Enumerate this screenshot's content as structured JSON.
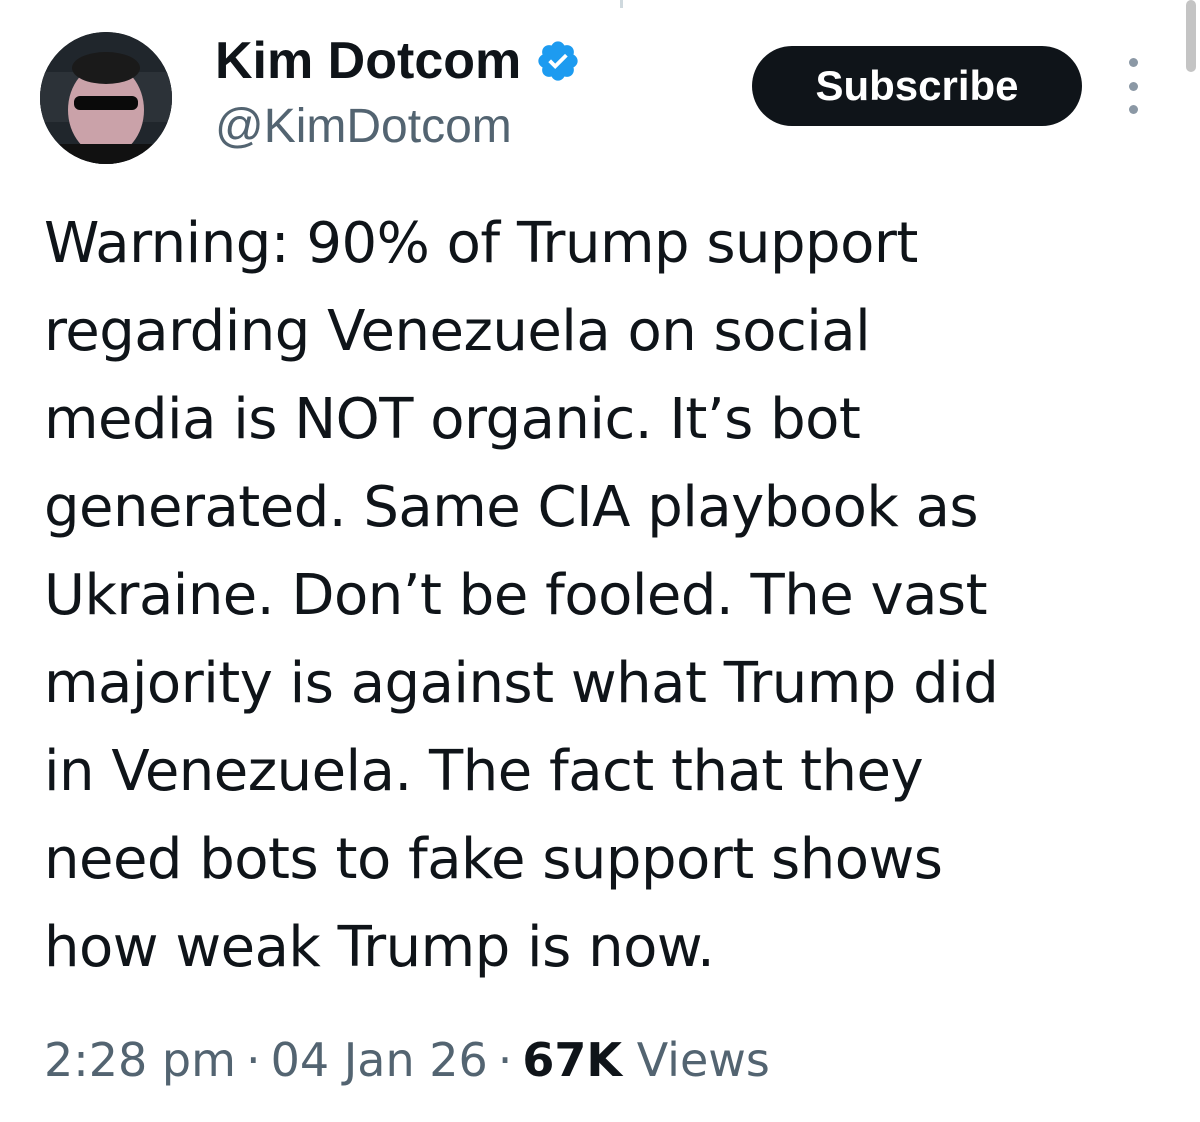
{
  "author": {
    "display_name": "Kim Dotcom",
    "handle": "@KimDotcom",
    "verified": true,
    "avatar": "profile-photo"
  },
  "actions": {
    "subscribe_label": "Subscribe",
    "more_icon": "more-vertical-icon"
  },
  "tweet": {
    "text": "Warning: 90% of Trump support\nregarding Venezuela on social\nmedia is NOT organic. It’s bot\ngenerated. Same CIA playbook as\nUkraine. Don’t be fooled. The vast\nmajority is against what Trump did\nin Venezuela. The fact that they\nneed bots to fake support shows\nhow weak Trump is now.",
    "time": "2:28 pm",
    "date": "04 Jan 26",
    "views_count": "67K",
    "views_label": "Views",
    "separator": "·"
  },
  "colors": {
    "text_primary": "#0f1419",
    "text_secondary": "#536471",
    "verified_blue": "#1d9bf0",
    "button_bg": "#0f1419"
  }
}
